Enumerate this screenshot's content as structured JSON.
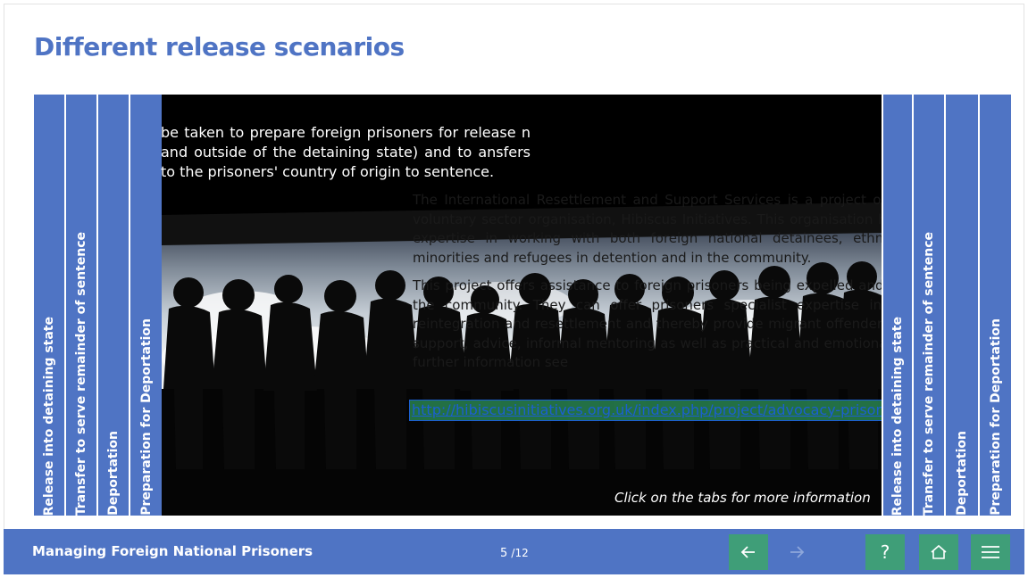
{
  "page": {
    "title": "Different release scenarios"
  },
  "tabs_left": [
    {
      "label": "Release into detaining state"
    },
    {
      "label": "Transfer to serve remainder of sentence"
    },
    {
      "label": "Deportation"
    },
    {
      "label": "Preparation for Deportation"
    }
  ],
  "tabs_right": [
    {
      "label": "Release into detaining state"
    },
    {
      "label": "Transfer to serve remainder of sentence"
    },
    {
      "label": "Deportation"
    },
    {
      "label": "Preparation for Deportation"
    }
  ],
  "content": {
    "text_a": "be taken to prepare foreign prisoners for release n and outside of the detaining state) and to ansfers to the prisoners' country of origin to sentence.",
    "para1": "The International Resettlement and Support Services is a project organised by a voluntary sector organisation, Hibiscus Initiatives. This organisation has developed expertise in working with both foreign national detainees, ethnic and racial minorities and refugees in detention and in the community.",
    "para2": "This project offers assistance to foreign prisoners being expelled and released into the community. They can offer prisoners specialist expertise in international reintegration and resettlement and thereby provide migrant offenders with welfare support, advice, informal mentoring as well as practical and emotional support. For further information see",
    "link": "http://hibiscusinitiatives.org.uk/index.php/project/advocacy-prison",
    "hint": "Click on the tabs for more information"
  },
  "footer": {
    "course_title": "Managing Foreign National Prisoners",
    "page_current": "5",
    "page_total": "/12",
    "back_icon": "arrow-left-icon",
    "next_icon": "arrow-right-icon",
    "help_label": "?",
    "home_icon": "home-icon",
    "menu_icon": "menu-icon"
  },
  "colors": {
    "accent": "#4f74c4",
    "nav_button": "#3f9e78"
  }
}
